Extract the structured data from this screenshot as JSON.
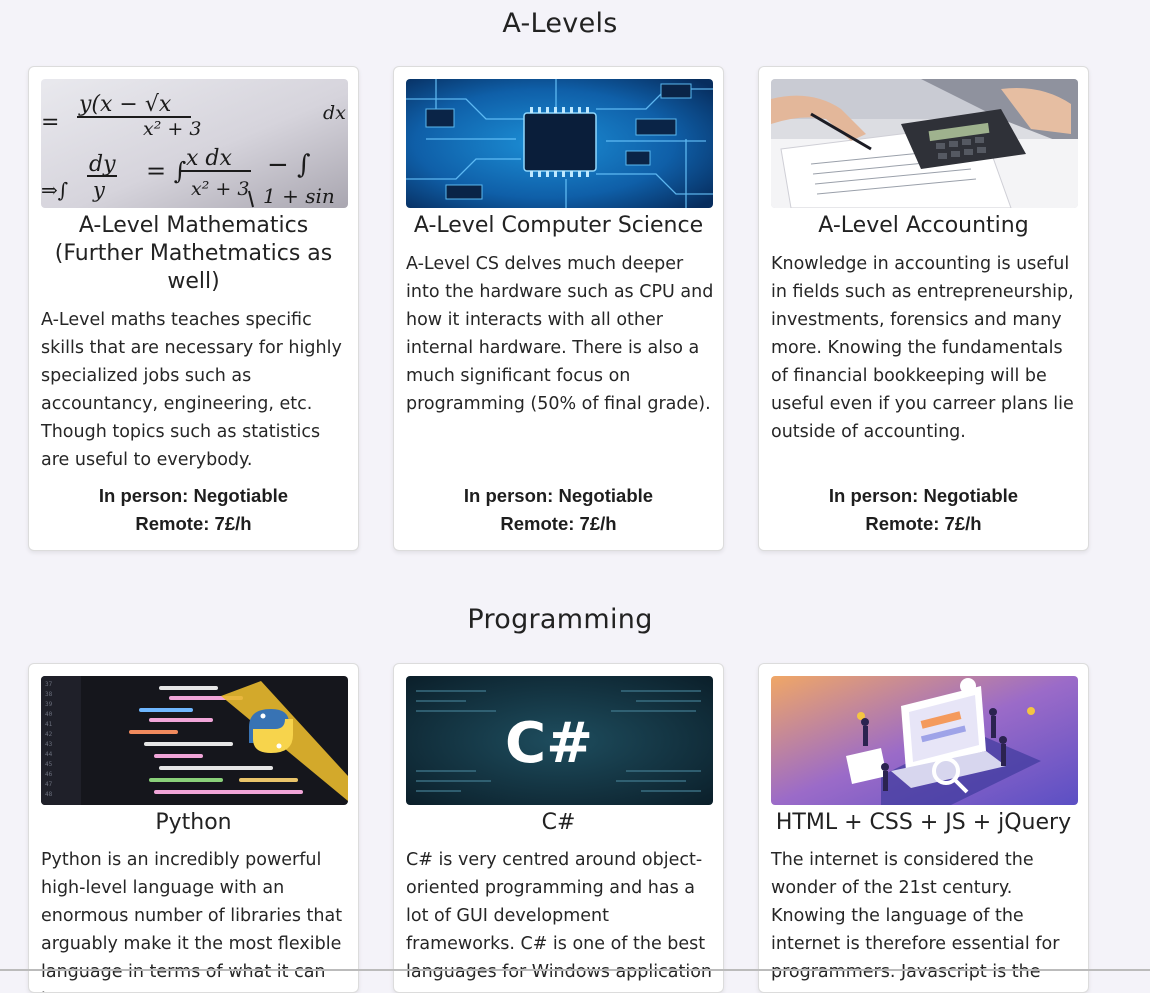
{
  "sections": [
    {
      "title": "A-Levels",
      "cards": [
        {
          "title_lines": [
            "A-Level Mathematics",
            "(Further Mathetmatics as",
            "well)"
          ],
          "desc_lines": [
            "A-Level maths teaches specific",
            "skills that are necessary for highly",
            "specialized jobs such as",
            "accountancy, engineering, etc.",
            "Though topics such as statistics",
            "are useful to everybody."
          ],
          "price_in_person": "In person: Negotiable",
          "price_remote": "Remote: 7£/h",
          "image_text": [
            "y(x − √x",
            "x² + 3",
            "dy",
            "y",
            "x dx",
            "x² + 3",
            "dx",
            "1 + sin"
          ]
        },
        {
          "title_lines": [
            "A-Level Computer Science"
          ],
          "desc_lines": [
            "A-Level CS delves much deeper",
            "into the hardware such as CPU and",
            "how it interacts with all other",
            "internal hardware. There is also a",
            "much significant focus on",
            "programming (50% of final grade)."
          ],
          "price_in_person": "In person: Negotiable",
          "price_remote": "Remote: 7£/h"
        },
        {
          "title_lines": [
            "A-Level Accounting"
          ],
          "desc_lines": [
            "Knowledge in accounting is useful",
            "in fields such as entrepreneurship,",
            "investments, forensics and many",
            "more. Knowing the fundamentals",
            "of financial bookkeeping will be",
            "useful even if you carreer plans lie",
            "outside of accounting."
          ],
          "price_in_person": "In person: Negotiable",
          "price_remote": "Remote: 7£/h"
        }
      ]
    },
    {
      "title": "Programming",
      "cards": [
        {
          "title_lines": [
            "Python"
          ],
          "desc_lines": [
            "Python is an incredibly powerful",
            "high-level language with an",
            "enormous number of libraries that",
            "arguably make it the most flexible",
            "language in terms of what it can be"
          ]
        },
        {
          "title_lines": [
            "C#"
          ],
          "desc_lines": [
            "C# is very centred around object-",
            "oriented programming and has a",
            "lot of GUI development",
            "frameworks. C# is one of the best",
            "languages for Windows application"
          ],
          "image_text": "C#"
        },
        {
          "title_lines": [
            "HTML + CSS + JS + jQuery"
          ],
          "desc_lines": [
            "The internet is considered the",
            "wonder of the 21st century.",
            "Knowing the language of the",
            "internet is therefore essential for",
            "programmers. Javascript is the"
          ]
        }
      ]
    }
  ]
}
